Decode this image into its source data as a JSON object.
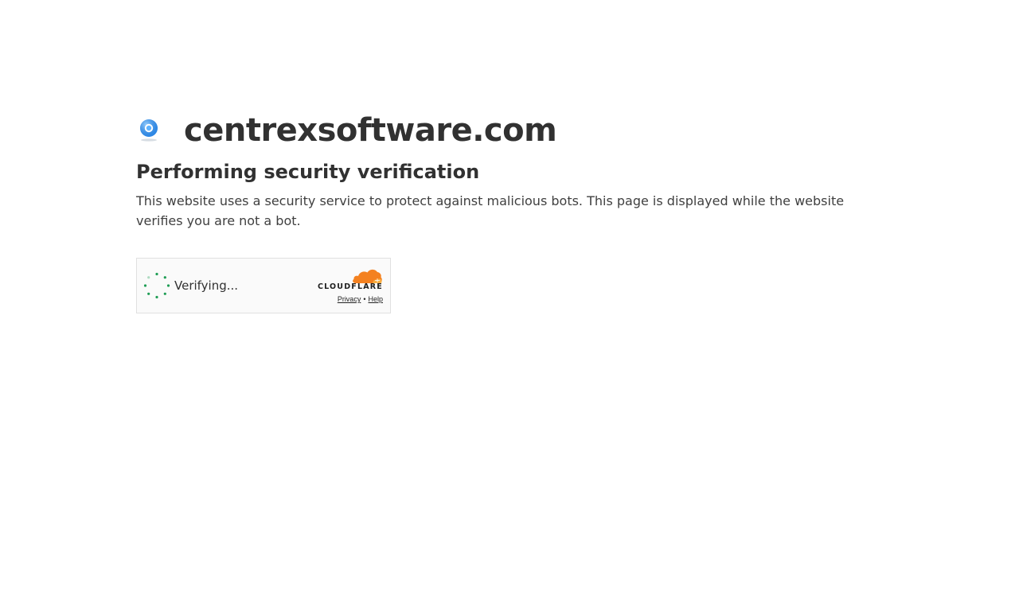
{
  "site": {
    "name": "centrexsoftware.com",
    "favicon": "circle-logo-icon"
  },
  "heading": "Performing security verification",
  "description": "This website uses a security service to protect against malicious bots. This page is displayed while the website verifies you are not a bot.",
  "widget": {
    "status": "Verifying...",
    "spinner_icon": "spinner-icon",
    "brand": "CLOUDFLARE",
    "links": {
      "privacy": "Privacy",
      "separator": "•",
      "help": "Help"
    }
  },
  "colors": {
    "text": "#313131",
    "spinner": "#1f9d55",
    "cloud_orange": "#f48120",
    "cloud_light": "#faad3f",
    "favicon_blue": "#2196f3"
  }
}
